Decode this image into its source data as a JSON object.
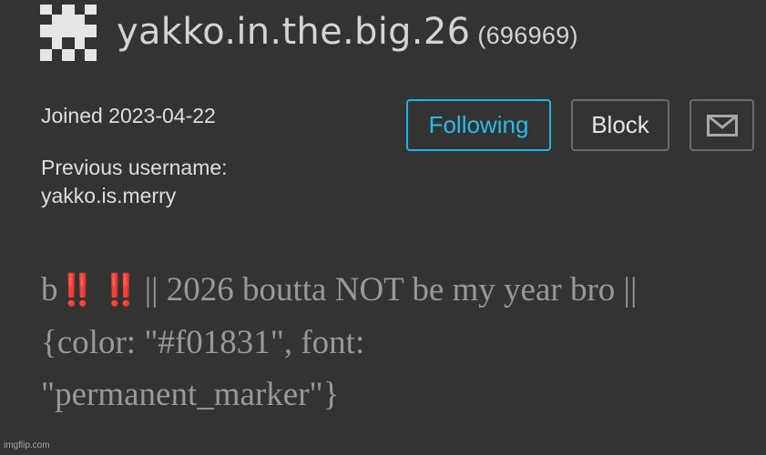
{
  "profile": {
    "username": "yakko.in.the.big.26",
    "user_id": "(696969)",
    "joined": "Joined 2023-04-22",
    "previous_username_label": "Previous username:",
    "previous_username": "yakko.is.merry",
    "avatar_icon": "pixel-avatar-icon"
  },
  "actions": {
    "following_label": "Following",
    "block_label": "Block",
    "message_icon": "mail-icon"
  },
  "bio": {
    "prefix": "b",
    "emoji_1": "‼️",
    "emoji_2": "‼️",
    "line_1_rest": "|| 2026 boutta NOT be my year bro ||",
    "line_2": "{color: \"#f01831\", font:",
    "line_3": "\"permanent_marker\"}"
  },
  "watermark": "imgflip.com",
  "colors": {
    "background": "#333333",
    "accent": "#1fb4e2",
    "bio_text": "#999999",
    "emoji_red": "#e8201a"
  }
}
